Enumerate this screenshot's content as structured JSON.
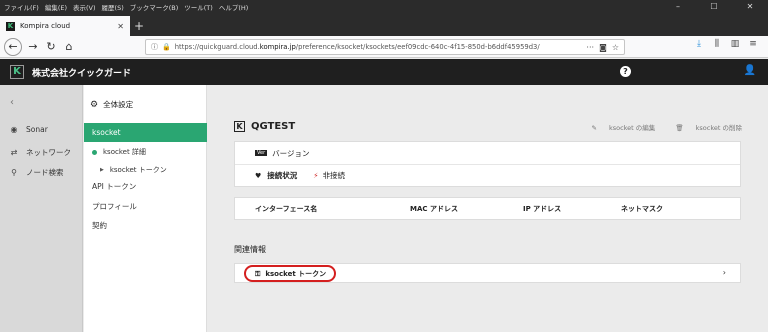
{
  "browser": {
    "menu": [
      "ファイル(F)",
      "編集(E)",
      "表示(V)",
      "履歴(S)",
      "ブックマーク(B)",
      "ツール(T)",
      "ヘルプ(H)"
    ],
    "tab_title": "Kompira cloud",
    "url_prefix": "https://quickguard.cloud.",
    "url_domain": "kompira.jp",
    "url_path": "/preference/ksocket/ksockets/eef09cdc-640c-4f15-850d-b6ddf45959d3/"
  },
  "app": {
    "company": "株式会社クイックガード"
  },
  "sidebar": {
    "items": [
      {
        "label": "Sonar",
        "icon": "sonar-icon"
      },
      {
        "label": "ネットワーク",
        "icon": "network-icon"
      },
      {
        "label": "ノード検索",
        "icon": "search-icon"
      }
    ]
  },
  "settings": {
    "header": "全体設定",
    "selected": "ksocket",
    "sub_items": [
      "ksocket 詳細",
      "ksocket トークン"
    ],
    "items": [
      "API トークン",
      "プロフィール",
      "契約"
    ]
  },
  "main": {
    "title": "QGTEST",
    "edit_label": "ksocket の編集",
    "delete_label": "ksocket の削除",
    "version_badge": "Ver",
    "version_label": "バージョン",
    "status_label": "接続状況",
    "status_value": "非接続",
    "columns": [
      "インターフェース名",
      "MAC アドレス",
      "IP アドレス",
      "ネットマスク"
    ],
    "related_title": "関連情報",
    "token_label": "ksocket トークン"
  }
}
